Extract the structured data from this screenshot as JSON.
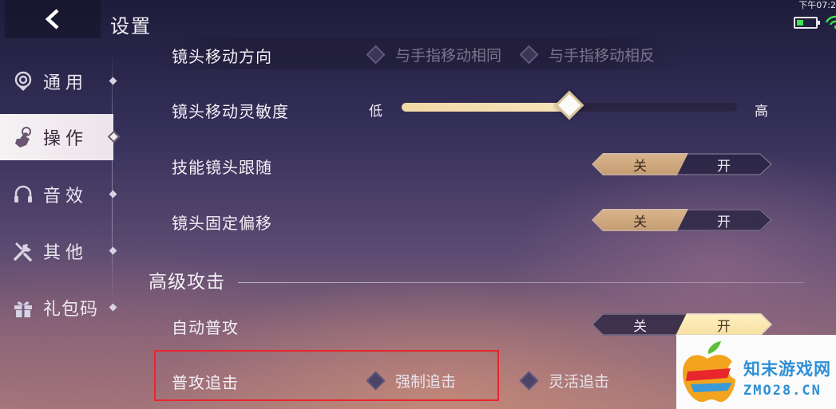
{
  "header": {
    "title": "设置",
    "status_time": "下午07:2"
  },
  "sidebar": {
    "items": [
      {
        "label": "通用",
        "icon": "general-icon",
        "active": false
      },
      {
        "label": "操作",
        "icon": "operation-hand-icon",
        "active": true
      },
      {
        "label": "音效",
        "icon": "headphone-icon",
        "active": false
      },
      {
        "label": "其他",
        "icon": "tools-icon",
        "active": false
      },
      {
        "label": "礼包码",
        "icon": "gift-icon",
        "active": false
      }
    ]
  },
  "settings": {
    "camera_direction": {
      "label": "镜头移动方向",
      "options": [
        "与手指移动相同",
        "与手指移动相反"
      ]
    },
    "camera_sensitivity": {
      "label": "镜头移动灵敏度",
      "min_label": "低",
      "max_label": "高",
      "value": 0.5
    },
    "skill_camera_follow": {
      "label": "技能镜头跟随",
      "off_label": "关",
      "on_label": "开",
      "selected": "off"
    },
    "camera_fixed_offset": {
      "label": "镜头固定偏移",
      "off_label": "关",
      "on_label": "开",
      "selected": "off"
    }
  },
  "advanced_attack": {
    "section_title": "高级攻击",
    "auto_attack": {
      "label": "自动普攻",
      "off_label": "关",
      "on_label": "开",
      "selected": "on"
    },
    "attack_chase": {
      "label": "普攻追击",
      "options": [
        "强制追击",
        "灵活追击"
      ]
    }
  },
  "watermark": {
    "name_cn": "知末游戏网",
    "name_en": "ZMO28.CN"
  },
  "colors": {
    "accent_cream": "#f6dea0",
    "accent_brown": "#c59c72",
    "highlight_red": "#e8262c",
    "watermark_blue": "#2e8fd6"
  }
}
